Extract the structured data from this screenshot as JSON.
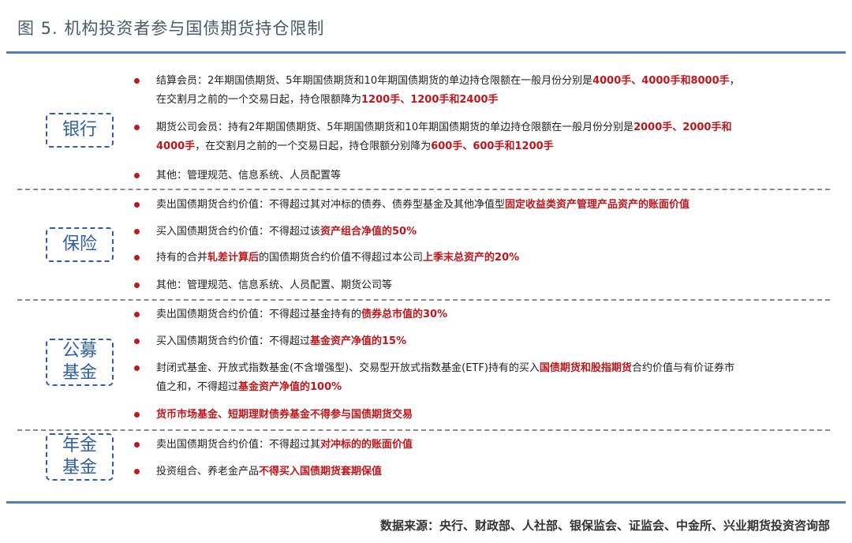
{
  "title": "图 5. 机构投资者参与国债期货持仓限制",
  "sections": {
    "bank": {
      "label": "银行",
      "i1": {
        "a": "结算会员：2年期国债期货、5年期国债期货和10年期国债期货的单边持仓限额在一般月份分别是",
        "b": "4000手、4000手和8000手",
        "c": "，",
        "d": "在交割月之前的一个交易日起，持仓限额降为",
        "e": "1200手、1200手和2400手"
      },
      "i2": {
        "a": "期货公司会员：持有2年期国债期货、5年期国债期货和10年期国债期货的单边持仓限额在一般月份分别是",
        "b": "2000手、2000手和",
        "c": "4000手",
        "d": "，在交割月之前的一个交易日起，持仓限额分别降为",
        "e": "600手、600手和1200手"
      },
      "i3": {
        "a": "其他：管理规范、信息系统、人员配置等"
      }
    },
    "insurance": {
      "label": "保险",
      "i1": {
        "a": "卖出国债期货合约价值：不得超过其对冲标的债券、债券型基金及其他净值型",
        "b": "固定收益类资产管理产品资产的账面价值"
      },
      "i2": {
        "a": "买入国债期货合约价值：不得超过该",
        "b": "资产组合净值的50%"
      },
      "i3": {
        "a": "持有的合并",
        "b": "轧差计算后",
        "c": "的国债期货合约价值不得超过本公司",
        "d": "上季末总资产的20%"
      },
      "i4": {
        "a": "其他：管理规范、信息系统、人员配置、期货公司等"
      }
    },
    "fund": {
      "label1": "公募",
      "label2": "基金",
      "i1": {
        "a": "卖出国债期货合约价值：不得超过基金持有的",
        "b": "债券总市值的30%"
      },
      "i2": {
        "a": "买入国债期货合约价值：不得超过",
        "b": "基金资产净值的15%"
      },
      "i3": {
        "a": "封闭式基金、开放式指数基金(不含增强型)、交易型开放式指数基金(ETF)持有的买入",
        "b": "国债期货和股指期货",
        "c": "合约价值与有价证券市",
        "d": "值之和，不得超过",
        "e": "基金资产净值的100%"
      },
      "i4": {
        "a": "货币市场基金、短期理财债券基金不得参与国债期货交易"
      }
    },
    "pension": {
      "label1": "年金",
      "label2": "基金",
      "i1": {
        "a": "卖出国债期货合约价值：不得超过其",
        "b": "对冲标的的账面价值"
      },
      "i2": {
        "a": "投资组合、养老金产品",
        "b": "不得买入国债期货套期保值"
      }
    }
  },
  "source": "数据来源：央行、财政部、人社部、银保监会、证监会、中金所、兴业期货投资咨询部",
  "colors": {
    "accent": "#4f7dbf",
    "highlight": "#c0161c",
    "label": "#2f5fa8"
  }
}
